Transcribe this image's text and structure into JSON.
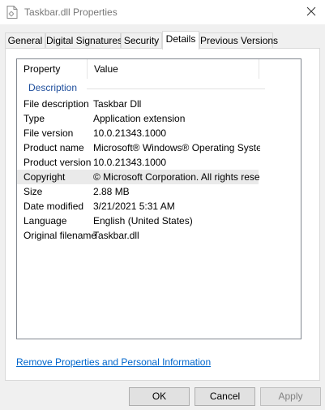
{
  "window": {
    "title": "Taskbar.dll Properties"
  },
  "tabs": [
    {
      "label": "General"
    },
    {
      "label": "Digital Signatures"
    },
    {
      "label": "Security"
    },
    {
      "label": "Details",
      "active": true
    },
    {
      "label": "Previous Versions"
    }
  ],
  "details": {
    "columns": {
      "property": "Property",
      "value": "Value"
    },
    "group": "Description",
    "rows": [
      {
        "name": "File description",
        "value": "Taskbar Dll"
      },
      {
        "name": "Type",
        "value": "Application extension"
      },
      {
        "name": "File version",
        "value": "10.0.21343.1000"
      },
      {
        "name": "Product name",
        "value": "Microsoft® Windows® Operating System"
      },
      {
        "name": "Product version",
        "value": "10.0.21343.1000"
      },
      {
        "name": "Copyright",
        "value": "© Microsoft Corporation. All rights reserv...",
        "selected": true
      },
      {
        "name": "Size",
        "value": "2.88 MB"
      },
      {
        "name": "Date modified",
        "value": "3/21/2021 5:31 AM"
      },
      {
        "name": "Language",
        "value": "English (United States)"
      },
      {
        "name": "Original filename",
        "value": "Taskbar.dll"
      }
    ]
  },
  "link": {
    "remove_properties": "Remove Properties and Personal Information"
  },
  "buttons": {
    "ok": "OK",
    "cancel": "Cancel",
    "apply": "Apply"
  },
  "colors": {
    "link": "#0066cc",
    "group_header": "#1e4e9c",
    "selected_row": "#eaeaea"
  },
  "icons": {
    "title": "document-icon",
    "close": "close-icon"
  }
}
